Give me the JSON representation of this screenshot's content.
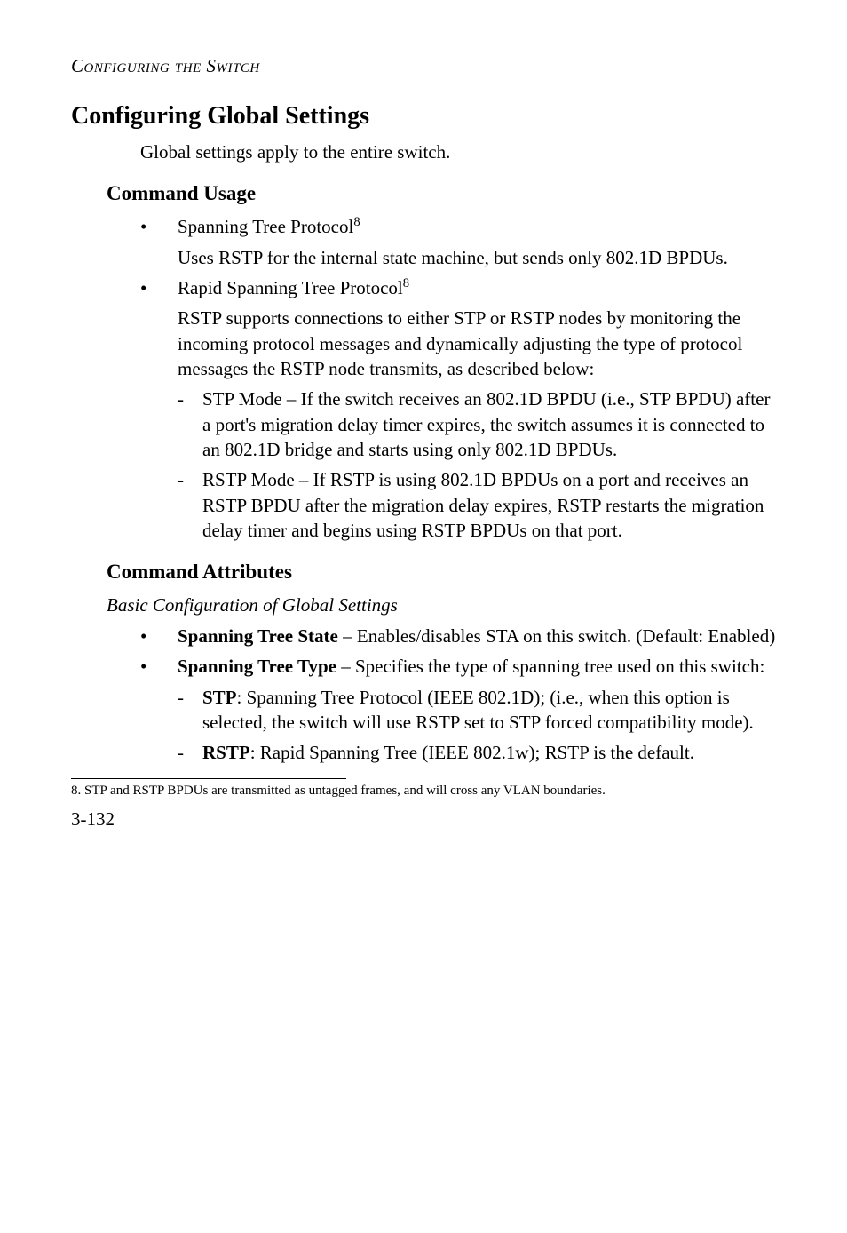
{
  "running_head": "Configuring the Switch",
  "section": {
    "title": "Configuring Global Settings",
    "intro": "Global settings apply to the entire switch."
  },
  "usage": {
    "heading": "Command Usage",
    "items": [
      {
        "title_pre": "Spanning Tree Protocol",
        "sup": "8",
        "desc": "Uses RSTP for the internal state machine, but sends only 802.1D BPDUs."
      },
      {
        "title_pre": "Rapid Spanning Tree Protocol",
        "sup": "8",
        "desc": "RSTP supports connections to either STP or RSTP nodes by monitoring the incoming protocol messages and dynamically adjusting the type of protocol messages the RSTP node transmits, as described below:",
        "sub": [
          "STP Mode – If the switch receives an 802.1D BPDU (i.e., STP BPDU) after a port's migration delay timer expires, the switch assumes it is connected to an 802.1D bridge and starts using only 802.1D BPDUs.",
          "RSTP Mode – If RSTP is using 802.1D BPDUs on a port and receives an RSTP BPDU after the migration delay expires, RSTP restarts the migration delay timer and begins using RSTP BPDUs on that port."
        ]
      }
    ]
  },
  "attrs": {
    "heading": "Command Attributes",
    "subtitle": "Basic Configuration of Global Settings",
    "items": [
      {
        "name": "Spanning Tree State",
        "desc": " – Enables/disables STA on this switch. (Default: Enabled)"
      },
      {
        "name": "Spanning Tree Type",
        "desc": " – Specifies the type of spanning tree used on this switch:",
        "sub": [
          {
            "name": "STP",
            "desc": ": Spanning Tree Protocol (IEEE 802.1D); (i.e., when this option is selected, the switch will use RSTP set to STP forced compatibility mode)."
          },
          {
            "name": "RSTP",
            "desc": ": Rapid Spanning Tree (IEEE 802.1w); RSTP is the default."
          }
        ]
      }
    ]
  },
  "footnote": {
    "marker": "8.",
    "text": "STP and RSTP BPDUs are transmitted as untagged frames, and will cross any VLAN boundaries."
  },
  "page_number": "3-132"
}
